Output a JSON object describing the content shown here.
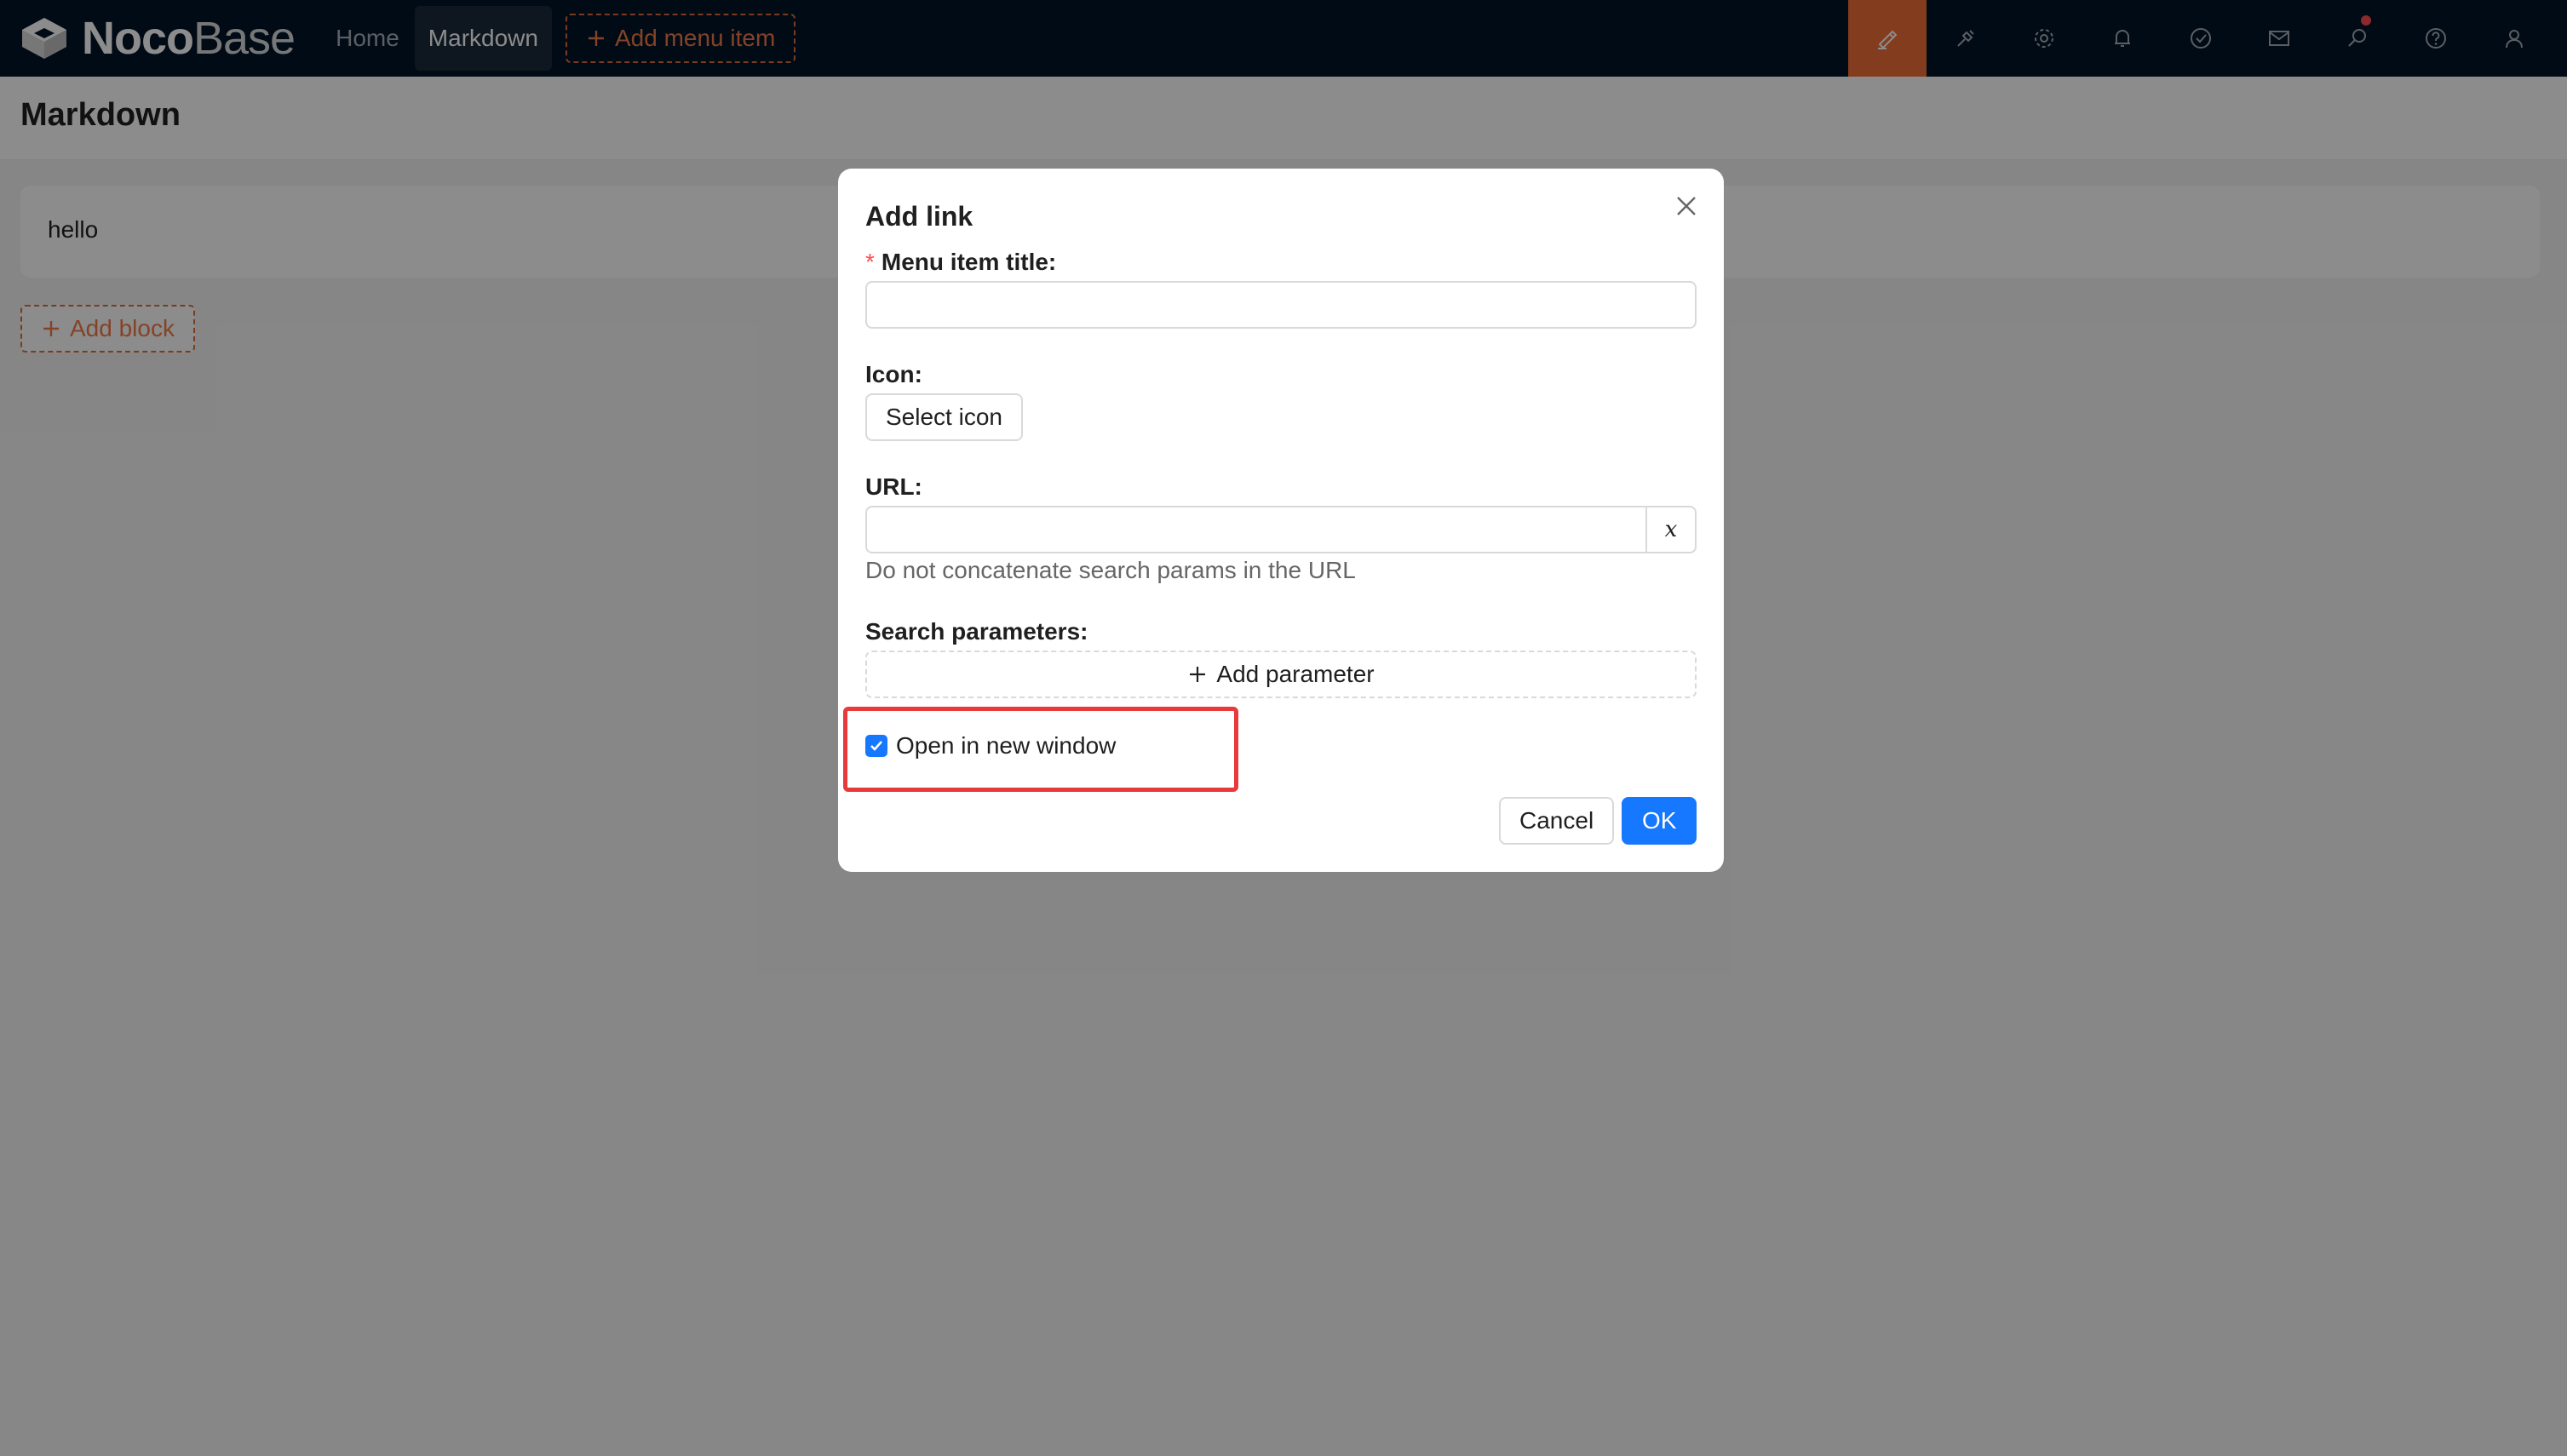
{
  "header": {
    "logo_noco": "Noco",
    "logo_base": "Base",
    "nav": [
      "Home",
      "Markdown"
    ],
    "add_menu_label": "Add menu item",
    "tools": [
      "ui-editor-icon",
      "plugin-manager-icon",
      "settings-icon",
      "bell-icon",
      "check-circle-icon",
      "mail-icon",
      "search-icon",
      "help-icon",
      "user-icon"
    ],
    "accent_color": "#f06d3a"
  },
  "page": {
    "title": "Markdown",
    "block_text": "hello",
    "add_block_label": "Add block"
  },
  "modal": {
    "title": "Add link",
    "menu_title_label": "Menu item title",
    "required_mark": "*",
    "menu_title_value": "",
    "icon_label": "Icon",
    "select_icon_label": "Select icon",
    "url_label": "URL",
    "url_value": "",
    "variable_button": "x",
    "url_hint": "Do not concatenate search params in the URL",
    "search_params_label": "Search parameters",
    "add_parameter_label": "Add parameter",
    "open_new_window_label": "Open in new window",
    "open_new_window_checked": true,
    "cancel_label": "Cancel",
    "ok_label": "OK",
    "primary_color": "#1677ff",
    "highlight_color": "#e8393b"
  }
}
